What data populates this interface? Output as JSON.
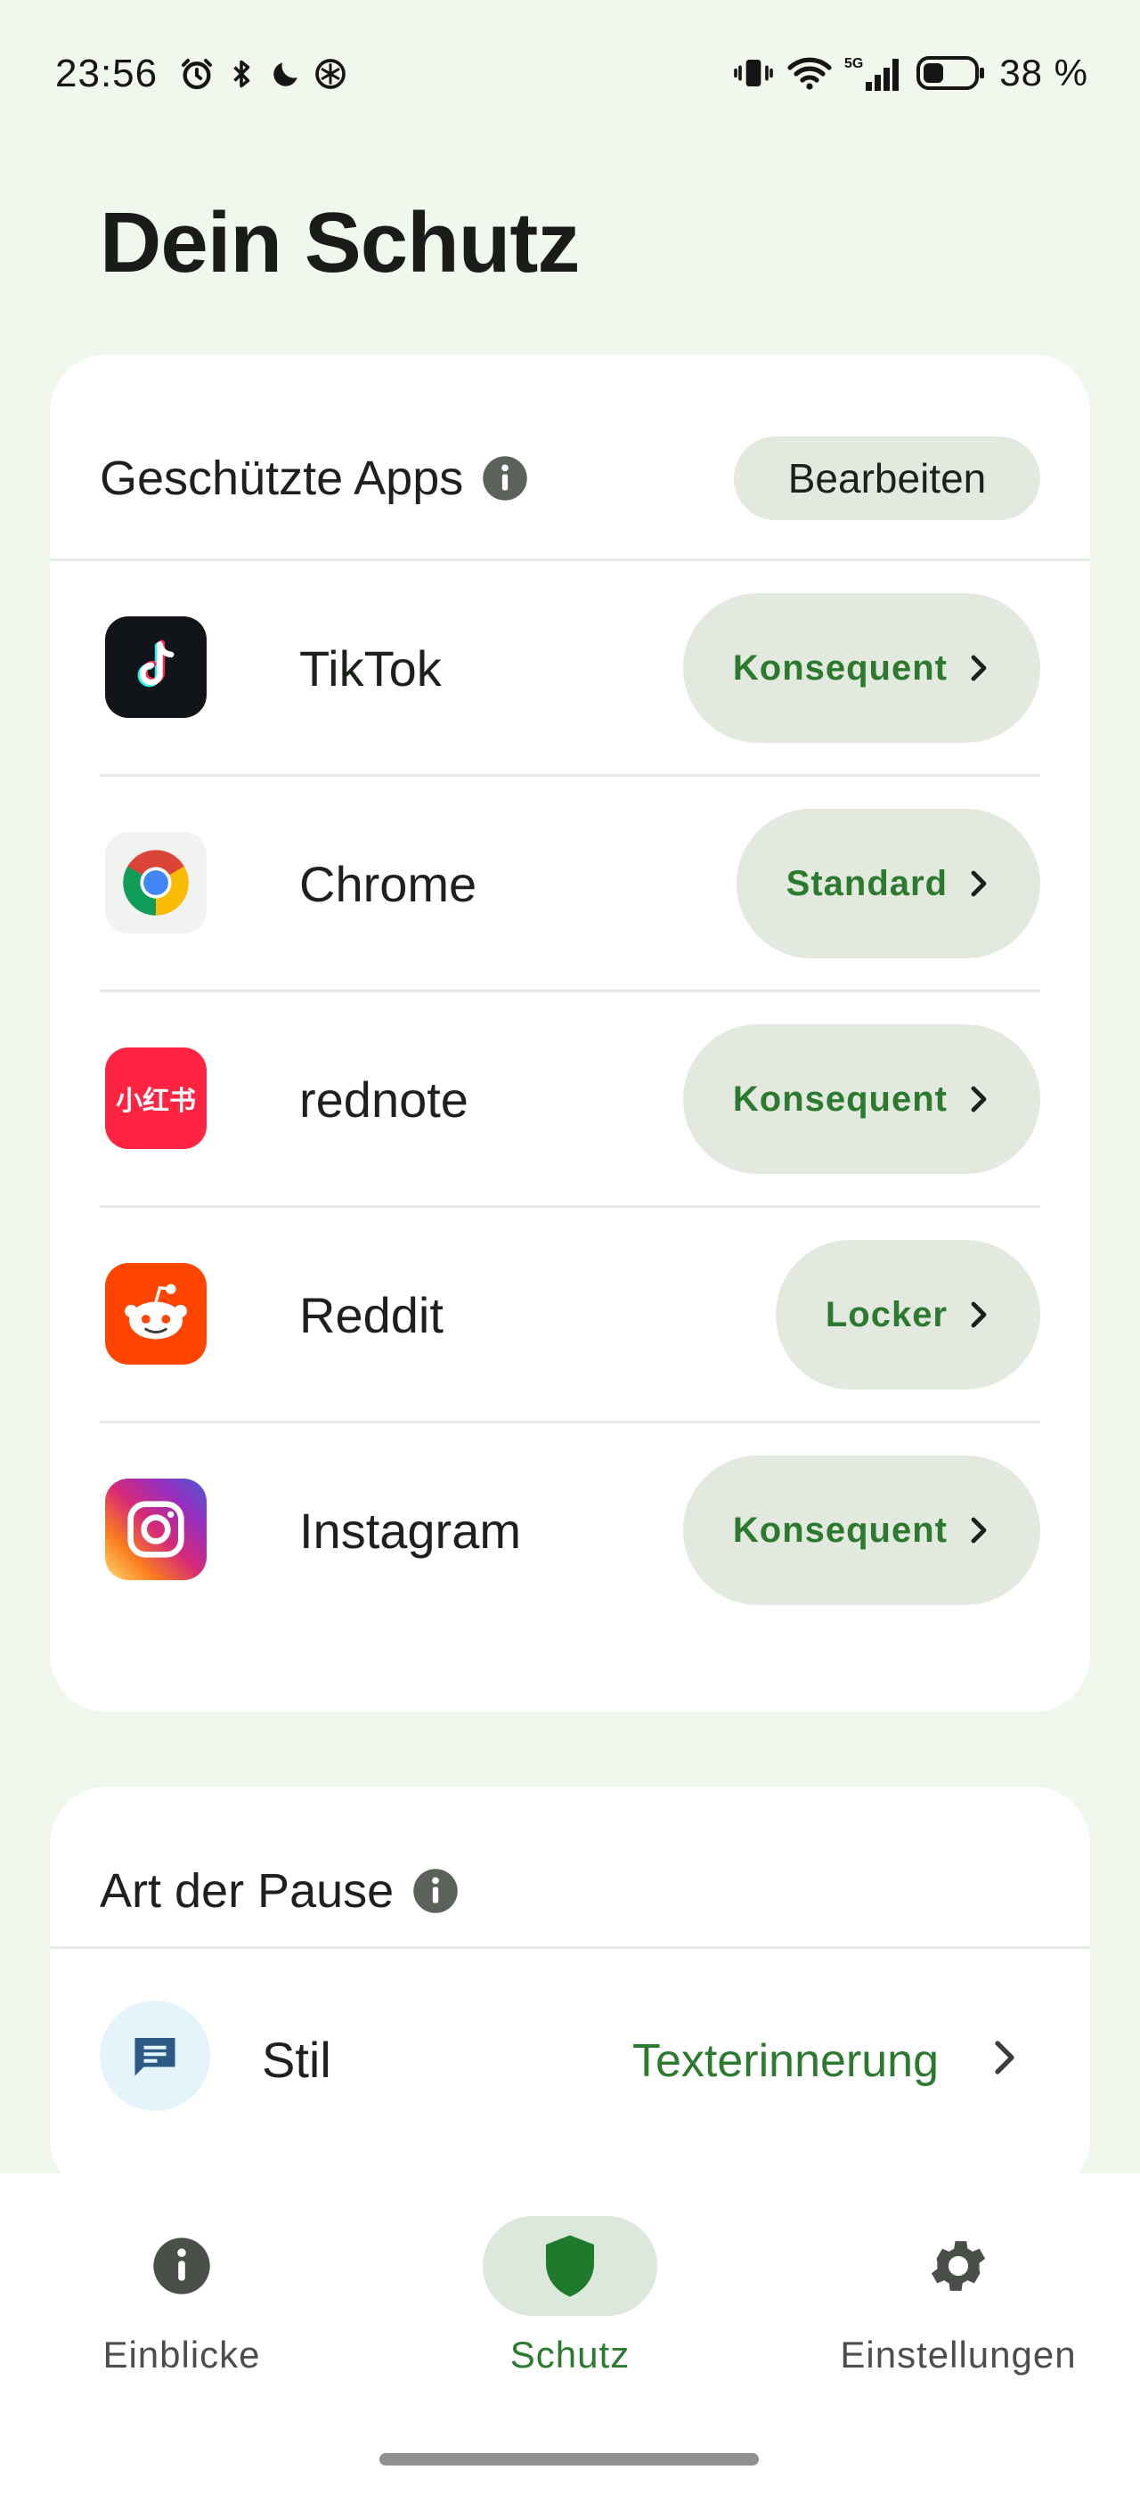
{
  "status_bar": {
    "time": "23:56",
    "left_icons": [
      "alarm-icon",
      "bluetooth-icon",
      "moon-icon",
      "chatgpt-icon"
    ],
    "right_icons": [
      "vibrate-icon",
      "wifi-icon",
      "signal-5g-icon",
      "battery-icon"
    ],
    "network_label": "5G",
    "battery": "38 %"
  },
  "page": {
    "title": "Dein Schutz"
  },
  "protected_apps": {
    "title": "Geschützte Apps",
    "edit_label": "Bearbeiten",
    "apps": [
      {
        "name": "TikTok",
        "mode": "Konsequent",
        "icon": "tiktok-icon"
      },
      {
        "name": "Chrome",
        "mode": "Standard",
        "icon": "chrome-icon"
      },
      {
        "name": "rednote",
        "mode": "Konsequent",
        "icon": "rednote-icon",
        "icon_text": "小红书"
      },
      {
        "name": "Reddit",
        "mode": "Locker",
        "icon": "reddit-icon"
      },
      {
        "name": "Instagram",
        "mode": "Konsequent",
        "icon": "instagram-icon"
      }
    ]
  },
  "pause_type": {
    "title": "Art der Pause",
    "style_label": "Stil",
    "style_value": "Texterinnerung",
    "style_icon": "message-icon"
  },
  "bottom_nav": {
    "items": [
      {
        "label": "Einblicke",
        "icon": "info-icon",
        "active": false
      },
      {
        "label": "Schutz",
        "icon": "shield-icon",
        "active": true
      },
      {
        "label": "Einstellungen",
        "icon": "gear-icon",
        "active": false
      }
    ]
  },
  "colors": {
    "background": "#f2f7ee",
    "card": "#ffffff",
    "pill": "#e3e9de",
    "accent_green": "#2b7a2f",
    "active_nav": "#1f7a2c"
  }
}
